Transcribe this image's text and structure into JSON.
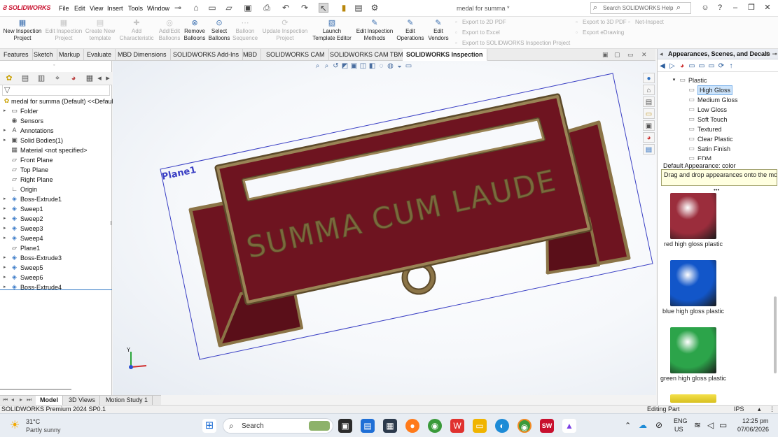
{
  "app": {
    "brand": "SOLIDWORKS",
    "document_title": "medal for summa *",
    "menu": [
      "File",
      "Edit",
      "View",
      "Insert",
      "Tools",
      "Window"
    ],
    "search_placeholder": "Search SOLIDWORKS Help"
  },
  "command_manager": {
    "commands": [
      {
        "label": "New Inspection Project",
        "enabled": true,
        "icon": "new-inspection-icon"
      },
      {
        "label": "Edit Inspection Project",
        "enabled": false,
        "icon": "edit-inspection-icon"
      },
      {
        "label": "Create New template",
        "enabled": false,
        "icon": "new-template-icon"
      },
      {
        "label": "Add Characteristic",
        "enabled": false,
        "icon": "add-characteristic-icon"
      },
      {
        "label": "Add/Edit Balloons",
        "enabled": false,
        "icon": "balloon-icon"
      },
      {
        "label": "Remove Balloons",
        "enabled": true,
        "icon": "remove-balloon-icon"
      },
      {
        "label": "Select Balloons",
        "enabled": true,
        "icon": "select-balloon-icon"
      },
      {
        "label": "Balloon Sequence",
        "enabled": false,
        "icon": "sequence-icon"
      },
      {
        "label": "Update Inspection Project",
        "enabled": false,
        "icon": "update-icon"
      },
      {
        "label": "Launch Template Editor",
        "enabled": true,
        "icon": "launch-icon"
      },
      {
        "label": "Edit Inspection Methods",
        "enabled": true,
        "icon": "methods-icon"
      },
      {
        "label": "Edit Operations",
        "enabled": true,
        "icon": "operations-icon"
      },
      {
        "label": "Edit Vendors",
        "enabled": true,
        "icon": "vendors-icon"
      }
    ],
    "exports_left": [
      "Export to 2D PDF",
      "Export to Excel",
      "Export to SOLIDWORKS Inspection Project"
    ],
    "exports_right": [
      "Export to 3D PDF",
      "Export eDrawing"
    ],
    "net_inspect": "Net-Inspect"
  },
  "tabs": [
    {
      "label": "Features",
      "active": false
    },
    {
      "label": "Sketch",
      "active": false
    },
    {
      "label": "Markup",
      "active": false
    },
    {
      "label": "Evaluate",
      "active": false
    },
    {
      "label": "MBD Dimensions",
      "active": false
    },
    {
      "label": "SOLIDWORKS Add-Ins",
      "active": false
    },
    {
      "label": "MBD",
      "active": false
    },
    {
      "label": "SOLIDWORKS CAM",
      "active": false
    },
    {
      "label": "SOLIDWORKS CAM TBM",
      "active": false
    },
    {
      "label": "SOLIDWORKS Inspection",
      "active": true
    }
  ],
  "feature_tree": {
    "root": "medal for summa (Default) <<Default",
    "items": [
      {
        "label": "Folder",
        "icon": "folder-icon",
        "expandable": true
      },
      {
        "label": "Sensors",
        "icon": "sensor-icon",
        "expandable": false
      },
      {
        "label": "Annotations",
        "icon": "annotation-icon",
        "expandable": true
      },
      {
        "label": "Solid Bodies(1)",
        "icon": "solid-bodies-icon",
        "expandable": true
      },
      {
        "label": "Material <not specified>",
        "icon": "material-icon",
        "expandable": false
      },
      {
        "label": "Front Plane",
        "icon": "plane-icon",
        "expandable": false
      },
      {
        "label": "Top Plane",
        "icon": "plane-icon",
        "expandable": false
      },
      {
        "label": "Right Plane",
        "icon": "plane-icon",
        "expandable": false
      },
      {
        "label": "Origin",
        "icon": "origin-icon",
        "expandable": false
      },
      {
        "label": "Boss-Extrude1",
        "icon": "extrude-icon",
        "expandable": true
      },
      {
        "label": "Sweep1",
        "icon": "sweep-icon",
        "expandable": true
      },
      {
        "label": "Sweep2",
        "icon": "sweep-icon",
        "expandable": true
      },
      {
        "label": "Sweep3",
        "icon": "sweep-icon",
        "expandable": true
      },
      {
        "label": "Sweep4",
        "icon": "sweep-icon",
        "expandable": true
      },
      {
        "label": "Plane1",
        "icon": "plane-icon",
        "expandable": false
      },
      {
        "label": "Boss-Extrude3",
        "icon": "extrude-icon",
        "expandable": true
      },
      {
        "label": "Sweep5",
        "icon": "sweep-icon",
        "expandable": true
      },
      {
        "label": "Sweep6",
        "icon": "sweep-icon",
        "expandable": true
      },
      {
        "label": "Boss-Extrude4",
        "icon": "extrude-icon",
        "expandable": true
      }
    ]
  },
  "bottom_tabs": [
    {
      "label": "Model",
      "active": true
    },
    {
      "label": "3D Views",
      "active": false
    },
    {
      "label": "Motion Study 1",
      "active": false
    }
  ],
  "graphics": {
    "model_text": "SUMMA CUM LAUDE",
    "plane_label": "Plane1",
    "axis_y": "Y",
    "colors": {
      "banner": "#6e1420",
      "border": "#8b7447",
      "plane": "#3a3fc4"
    }
  },
  "task_pane": {
    "title": "Appearances, Scenes, and Decals",
    "tree": [
      {
        "label": "Plastic",
        "level": 0,
        "selected": false
      },
      {
        "label": "High Gloss",
        "level": 1,
        "selected": true
      },
      {
        "label": "Medium Gloss",
        "level": 1,
        "selected": false
      },
      {
        "label": "Low Gloss",
        "level": 1,
        "selected": false
      },
      {
        "label": "Soft Touch",
        "level": 1,
        "selected": false
      },
      {
        "label": "Textured",
        "level": 1,
        "selected": false
      },
      {
        "label": "Clear Plastic",
        "level": 1,
        "selected": false
      },
      {
        "label": "Satin Finish",
        "level": 1,
        "selected": false
      },
      {
        "label": "EDM",
        "level": 1,
        "selected": false
      }
    ],
    "default_appearance": "Default Appearance: color",
    "tip": "Drag and drop appearances onto the mo...",
    "swatches": [
      {
        "label": "red high gloss plastic",
        "color": "#9b2d3c"
      },
      {
        "label": "blue high gloss plastic",
        "color": "#1256c9"
      },
      {
        "label": "green high gloss plastic",
        "color": "#2ca44a"
      }
    ]
  },
  "status_bar": {
    "left": "SOLIDWORKS Premium 2024 SP0.1",
    "mode": "Editing Part",
    "units": "IPS"
  },
  "taskbar": {
    "temperature": "31°C",
    "weather": "Partly sunny",
    "search": "Search",
    "language": "ENG",
    "region": "US",
    "time": "12:25 pm",
    "date": "07/06/2026"
  }
}
